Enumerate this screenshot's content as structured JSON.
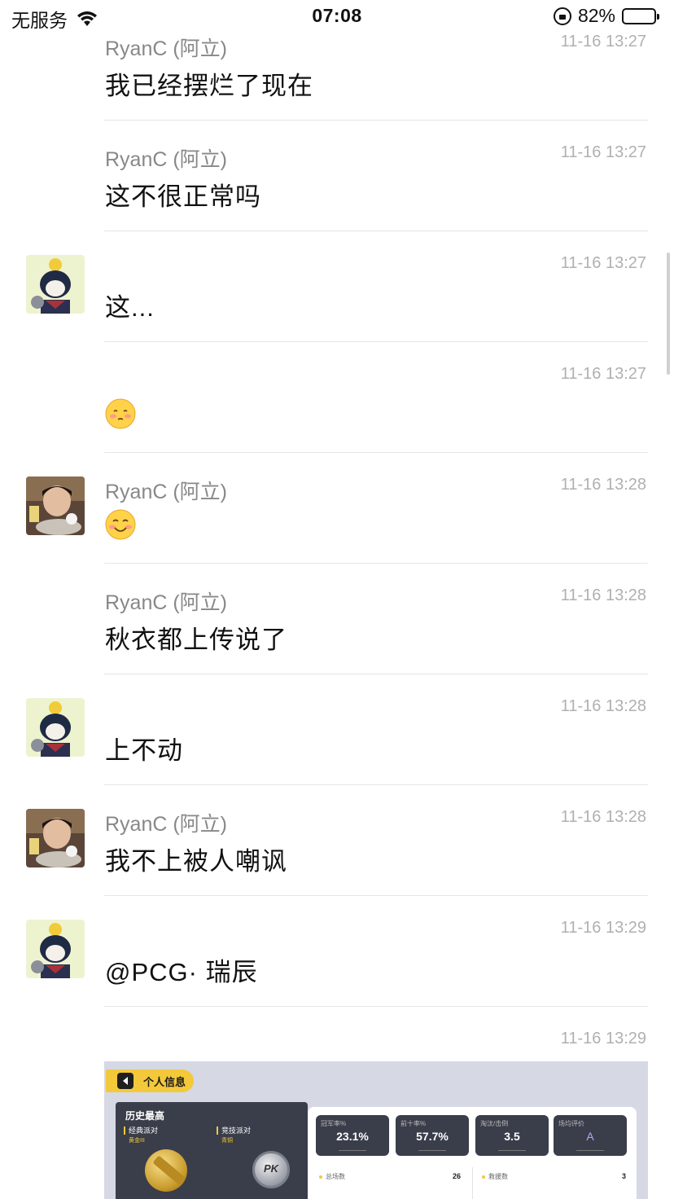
{
  "status_bar": {
    "carrier": "无服务",
    "time": "07:08",
    "battery": "82%",
    "battery_level": 0.82
  },
  "messages": [
    {
      "sender": "RyanC (阿立)",
      "time": "11-16 13:27",
      "text": "我已经摆烂了现在"
    },
    {
      "sender": "RyanC (阿立)",
      "time": "11-16 13:27",
      "text": "这不很正常吗"
    },
    {
      "sender": "",
      "time": "11-16 13:27",
      "text": "这..."
    },
    {
      "sender": "",
      "time": "11-16 13:27",
      "emoji": "blush-face"
    },
    {
      "sender": "RyanC (阿立)",
      "time": "11-16 13:28",
      "emoji": "smile-face"
    },
    {
      "sender": "RyanC (阿立)",
      "time": "11-16 13:28",
      "text": "秋衣都上传说了"
    },
    {
      "sender": "",
      "time": "11-16 13:28",
      "text": "上不动"
    },
    {
      "sender": "RyanC (阿立)",
      "time": "11-16 13:28",
      "text": "我不上被人嘲讽"
    },
    {
      "sender": "",
      "time": "11-16 13:29",
      "text": "@PCG· 瑞辰"
    },
    {
      "sender": "",
      "time": "11-16 13:29",
      "image": "game-stats-screenshot"
    }
  ],
  "screenshot": {
    "tab_label": "个人信息",
    "section_title": "历史最高",
    "modes": [
      {
        "name": "经典派对",
        "rank": "黄金III"
      },
      {
        "name": "竞技派对",
        "rank": "青铜"
      }
    ],
    "silver_badge_text": "PK",
    "stats": [
      {
        "label": "冠军率%",
        "value": "23.1%"
      },
      {
        "label": "前十率%",
        "value": "57.7%"
      },
      {
        "label": "淘汰/击倒",
        "value": "3.5"
      },
      {
        "label": "场均评价",
        "value": "A"
      }
    ],
    "rows": [
      {
        "label": "总场数",
        "value": "26"
      },
      {
        "label": "救援数",
        "value": "3"
      }
    ]
  },
  "colors": {
    "accent_yellow": "#f3c93b",
    "panel_dark": "#3a3d4a",
    "timestamp": "#b0b0b0",
    "sender": "#888888"
  }
}
